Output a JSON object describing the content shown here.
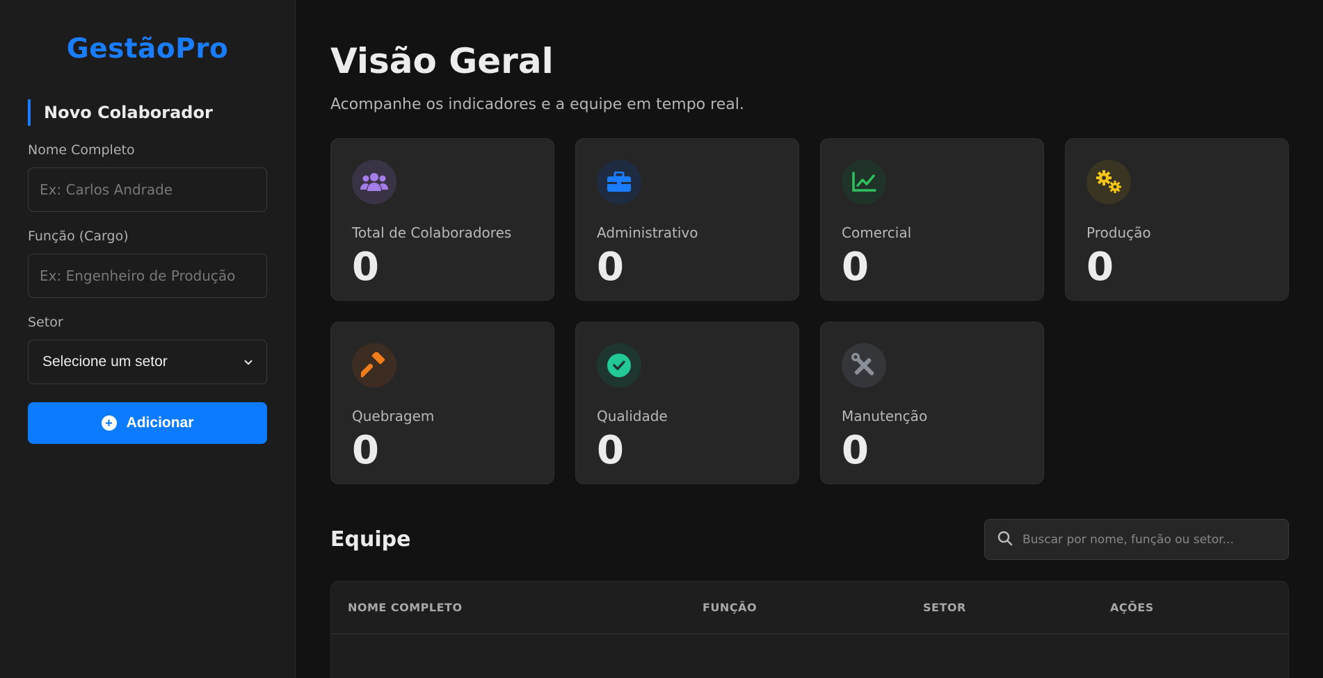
{
  "sidebar": {
    "logo": "GestãoPro",
    "form_title": "Novo Colaborador",
    "fields": {
      "name_label": "Nome Completo",
      "name_placeholder": "Ex: Carlos Andrade",
      "role_label": "Função (Cargo)",
      "role_placeholder": "Ex: Engenheiro de Produção",
      "sector_label": "Setor",
      "sector_selected": "Selecione um setor"
    },
    "add_button": "Adicionar"
  },
  "main": {
    "title": "Visão Geral",
    "subtitle": "Acompanhe os indicadores e a equipe em tempo real.",
    "cards": [
      {
        "label": "Total de Colaboradores",
        "value": "0",
        "icon": "users-icon",
        "color": "#a47de8"
      },
      {
        "label": "Administrativo",
        "value": "0",
        "icon": "briefcase-icon",
        "color": "#1a7cff"
      },
      {
        "label": "Comercial",
        "value": "0",
        "icon": "chart-line-icon",
        "color": "#2fbf5f"
      },
      {
        "label": "Produção",
        "value": "0",
        "icon": "gears-icon",
        "color": "#f5c518"
      },
      {
        "label": "Quebragem",
        "value": "0",
        "icon": "hammer-icon",
        "color": "#f07d1a"
      },
      {
        "label": "Qualidade",
        "value": "0",
        "icon": "check-circle-icon",
        "color": "#22c997"
      },
      {
        "label": "Manutenção",
        "value": "0",
        "icon": "tools-icon",
        "color": "#8a8f98"
      }
    ],
    "team": {
      "title": "Equipe",
      "search_placeholder": "Buscar por nome, função ou setor...",
      "columns": [
        "NOME COMPLETO",
        "FUNÇÃO",
        "SETOR",
        "AÇÕES"
      ]
    }
  }
}
